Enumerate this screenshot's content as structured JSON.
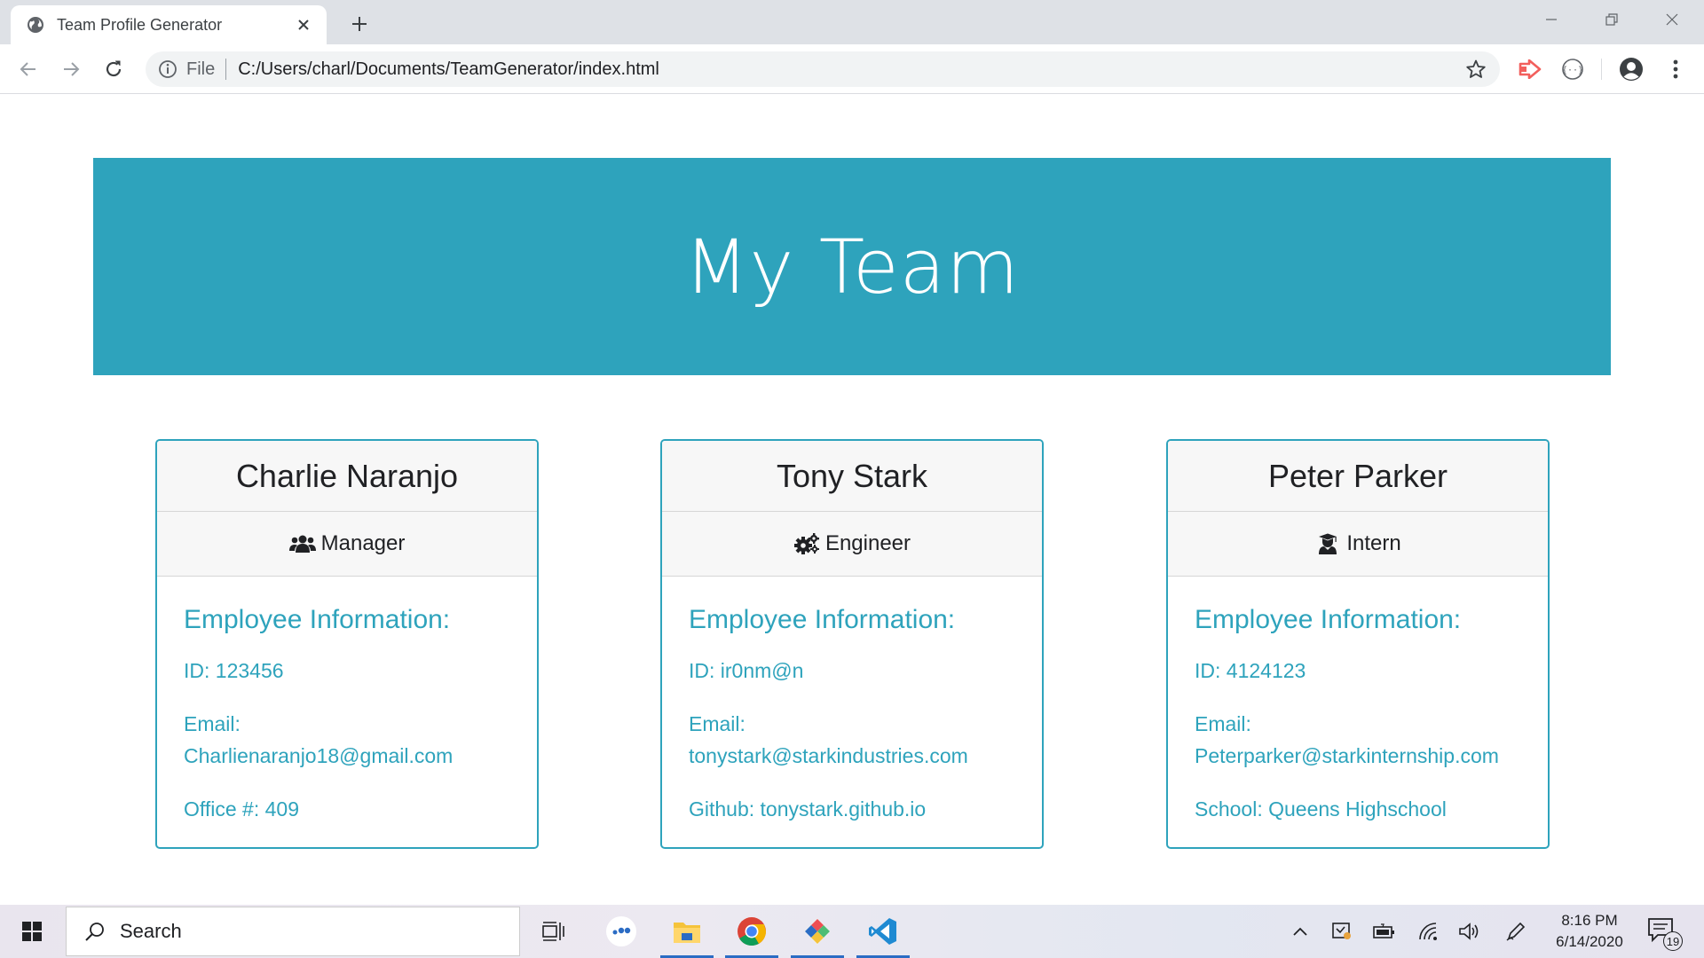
{
  "browser": {
    "tab_title": "Team Profile Generator",
    "omnibox_scheme": "File",
    "url": "C:/Users/charl/Documents/TeamGenerator/index.html"
  },
  "page": {
    "title": "My Team",
    "info_heading": "Employee Information:",
    "accent_color": "#2ea3bc",
    "employees": [
      {
        "name": "Charlie Naranjo",
        "role": "Manager",
        "role_icon": "users-icon",
        "id": "ID: 123456",
        "email_label": "Email:",
        "email": "Charlienaranjo18@gmail.com",
        "extra": "Office #: 409"
      },
      {
        "name": "Tony Stark",
        "role": "Engineer",
        "role_icon": "cogs-icon",
        "id": "ID: ir0nm@n",
        "email_label": "Email:",
        "email": "tonystark@starkindustries.com",
        "extra": "Github: tonystark.github.io"
      },
      {
        "name": "Peter Parker",
        "role": "Intern",
        "role_icon": "graduate-icon",
        "id": "ID: 4124123",
        "email_label": "Email:",
        "email": "Peterparker@starkinternship.com",
        "extra": "School: Queens Highschool"
      }
    ]
  },
  "taskbar": {
    "search_label": "Search",
    "time": "8:16 PM",
    "date": "6/14/2020",
    "notification_count": "19"
  }
}
